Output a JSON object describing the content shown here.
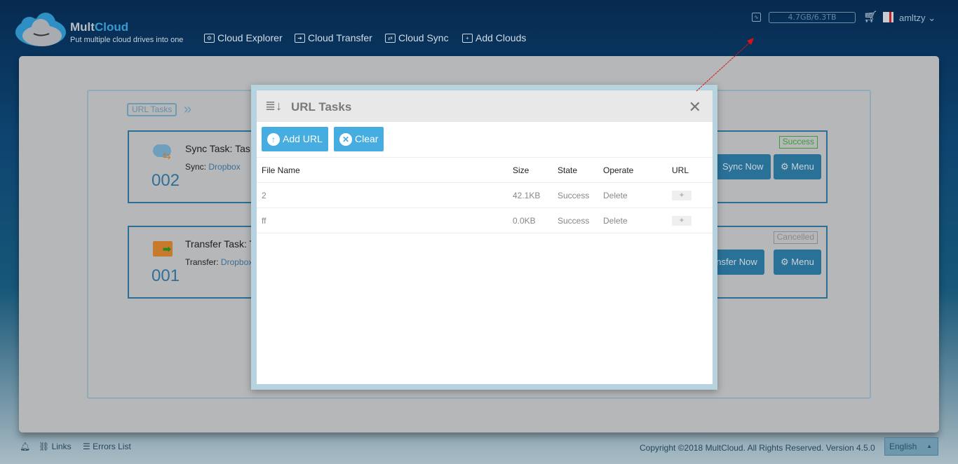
{
  "header": {
    "brand_part1": "Mult",
    "brand_part2": "Cloud",
    "tagline": "Put multiple cloud drives into one",
    "nav": [
      {
        "label": "Cloud Explorer",
        "icon": "folder-gear-icon"
      },
      {
        "label": "Cloud Transfer",
        "icon": "folder-arrow-icon"
      },
      {
        "label": "Cloud Sync",
        "icon": "folder-sync-icon"
      },
      {
        "label": "Add Clouds",
        "icon": "folder-plus-icon"
      }
    ],
    "storage": "4.7GB/6.3TB",
    "username": "amltzy"
  },
  "breadcrumb": {
    "label": "URL Tasks"
  },
  "tasks": [
    {
      "title": "Sync Task: Tas",
      "sub_label": "Sync:",
      "sub_value": "Dropbox",
      "number": "002",
      "status": "Success",
      "status_color": "#3c9a3c",
      "action": "Sync Now",
      "menu": "Menu"
    },
    {
      "title": "Transfer Task: T",
      "sub_label": "Transfer:",
      "sub_value": "Dropbox",
      "number": "001",
      "status": "Cancelled",
      "status_color": "#8a8a8a",
      "action": "ansfer Now",
      "menu": "Menu"
    }
  ],
  "modal": {
    "title": "URL Tasks",
    "add_url": "Add URL",
    "clear": "Clear",
    "columns": [
      "File Name",
      "Size",
      "State",
      "Operate",
      "URL"
    ],
    "rows": [
      {
        "name": "2",
        "size": "42.1KB",
        "state": "Success",
        "operate": "Delete"
      },
      {
        "name": "ff",
        "size": "0.0KB",
        "state": "Success",
        "operate": "Delete"
      }
    ]
  },
  "footer": {
    "links": "Links",
    "errors": "Errors List",
    "copyright": "Copyright ©2018 MultCloud. All Rights Reserved. Version 4.5.0",
    "language": "English"
  }
}
